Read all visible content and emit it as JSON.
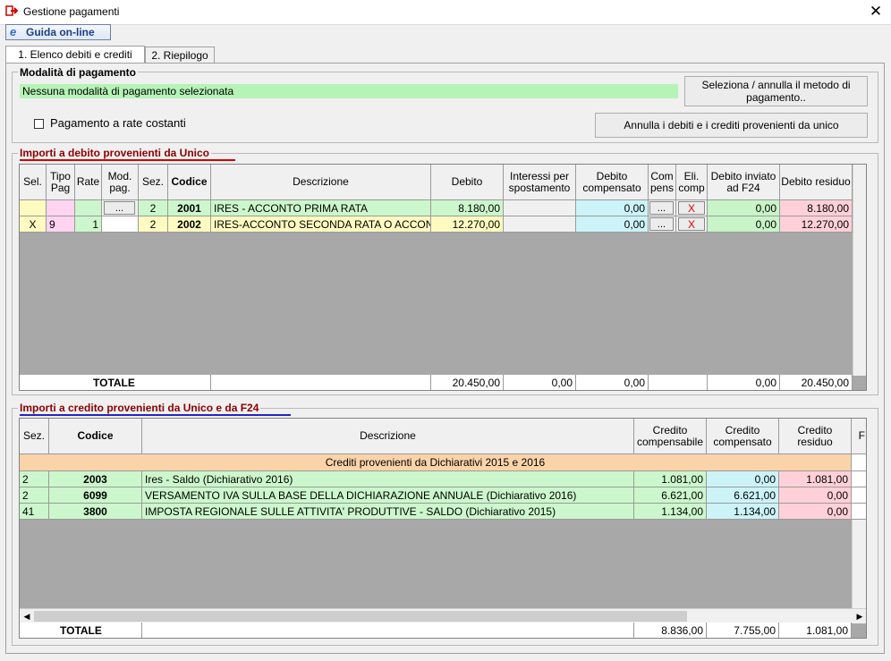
{
  "window": {
    "title": "Gestione pagamenti",
    "close_glyph": "✕"
  },
  "toolbar": {
    "help_label": "Guida on-line"
  },
  "tabs": [
    {
      "label": "1. Elenco debiti e crediti",
      "active": true
    },
    {
      "label": "2. Riepilogo",
      "active": false
    }
  ],
  "payment": {
    "group_title": "Modalità di pagamento",
    "status": "Nessuna modalità di pagamento selezionata",
    "select_button": "Seleziona / annulla il metodo di pagamento..",
    "installments_label": "Pagamento a rate costanti",
    "installments_checked": false,
    "cancel_button": "Annulla i debiti e i crediti provenienti da unico"
  },
  "debits": {
    "group_title": "Importi a debito provenienti da Unico",
    "headers": [
      "Sel.",
      "Tipo Pag",
      "Rate",
      "Mod. pag.",
      "Sez.",
      "Codice",
      "Descrizione",
      "Debito",
      "Interessi per spostamento",
      "Debito compensato",
      "Com pens",
      "Eli. comp",
      "Debito inviato ad F24",
      "Debito residuo"
    ],
    "rows": [
      {
        "sel": "",
        "tipo": "",
        "rate": "",
        "mod": "...",
        "sez": "2",
        "codice": "2001",
        "descrizione": "IRES - ACCONTO PRIMA RATA",
        "debito": "8.180,00",
        "interessi": "",
        "compensato": "0,00",
        "compens": "...",
        "eli": "X",
        "inviato": "0,00",
        "residuo": "8.180,00"
      },
      {
        "sel": "X",
        "tipo": "9",
        "rate": "1",
        "mod": "",
        "sez": "2",
        "codice": "2002",
        "descrizione": "IRES-ACCONTO SECONDA RATA O ACCONT",
        "debito": "12.270,00",
        "interessi": "",
        "compensato": "0,00",
        "compens": "...",
        "eli": "X",
        "inviato": "0,00",
        "residuo": "12.270,00"
      }
    ],
    "total": {
      "label": "TOTALE",
      "debito": "20.450,00",
      "interessi": "0,00",
      "compensato": "0,00",
      "inviato": "0,00",
      "residuo": "20.450,00"
    }
  },
  "credits": {
    "group_title": "Importi a credito provenienti da Unico e da F24",
    "headers": [
      "Sez.",
      "Codice",
      "Descrizione",
      "Credito compensabile",
      "Credito compensato",
      "Credito residuo",
      "F"
    ],
    "section_label": "Crediti provenienti da Dichiarativi 2015 e 2016",
    "rows": [
      {
        "sez": "2",
        "codice": "2003",
        "descrizione": "Ires - Saldo (Dichiarativo 2016)",
        "compensabile": "1.081,00",
        "compensato": "0,00",
        "residuo": "1.081,00"
      },
      {
        "sez": "2",
        "codice": "6099",
        "descrizione": "VERSAMENTO IVA SULLA BASE DELLA DICHIARAZIONE ANNUALE (Dichiarativo 2016)",
        "compensabile": "6.621,00",
        "compensato": "6.621,00",
        "residuo": "0,00"
      },
      {
        "sez": "41",
        "codice": "3800",
        "descrizione": "IMPOSTA REGIONALE SULLE ATTIVITA' PRODUTTIVE - SALDO (Dichiarativo 2015)",
        "compensabile": "1.134,00",
        "compensato": "1.134,00",
        "residuo": "0,00"
      }
    ],
    "total": {
      "label": "TOTALE",
      "compensabile": "8.836,00",
      "compensato": "7.755,00",
      "residuo": "1.081,00"
    }
  },
  "colors": {
    "green": "#b6f3b6",
    "row_green": "#ccf7cc",
    "row_yellow": "#fffbc0",
    "pink": "#ffcfe0",
    "cyan": "#ccf3f8",
    "peach": "#fbd3a9",
    "red_text": "#8b0000"
  }
}
